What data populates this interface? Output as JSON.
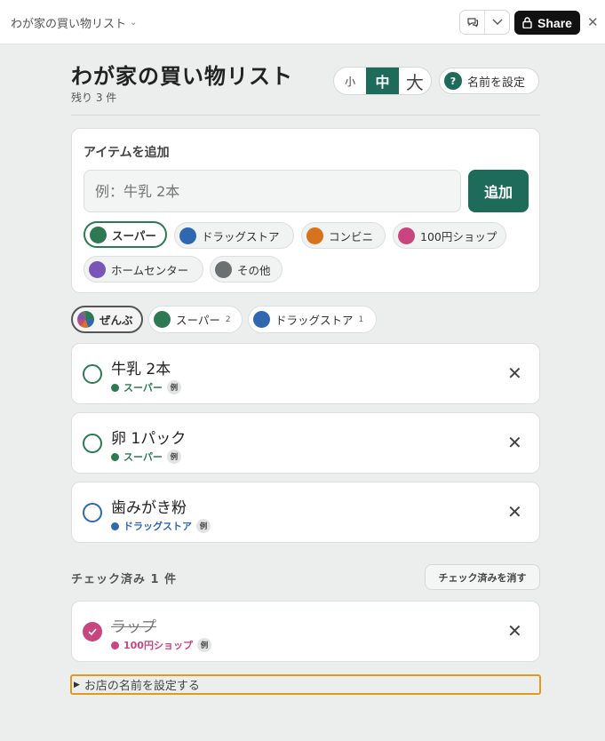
{
  "topbar": {
    "title": "わが家の買い物リスト",
    "share_label": "Share",
    "chat_icon": "chat-icon",
    "dropdown_icon": "chevron-down-icon"
  },
  "header": {
    "title": "わが家の買い物リスト",
    "remaining": "残り 3 件",
    "sizes": [
      "小",
      "中",
      "大"
    ],
    "selected_size": "中",
    "name_button_icon": "?",
    "name_button_label": "名前を設定"
  },
  "add": {
    "heading": "アイテムを追加",
    "placeholder": "例：牛乳 2本",
    "button_label": "追加",
    "stores": [
      {
        "label": "スーパー",
        "color": "#2d7a52",
        "selected": true
      },
      {
        "label": "ドラッグストア",
        "color": "#2f68b0"
      },
      {
        "label": "コンビニ",
        "color": "#d9721c"
      },
      {
        "label": "100円ショップ",
        "color": "#c84580"
      },
      {
        "label": "ホームセンター",
        "color": "#7a55b8"
      },
      {
        "label": "その他",
        "color": "#6d7070"
      }
    ]
  },
  "filters": [
    {
      "label": "ぜんぶ",
      "count": ""
    },
    {
      "label": "スーパー",
      "count": "2"
    },
    {
      "label": "ドラッグストア",
      "count": "1"
    }
  ],
  "items": [
    {
      "name": "牛乳 2本",
      "store": "スーパー",
      "badge": "例",
      "color": "#2d7a52"
    },
    {
      "name": "卵 1パック",
      "store": "スーパー",
      "badge": "例",
      "color": "#2d7a52"
    },
    {
      "name": "歯みがき粉",
      "store": "ドラッグストア",
      "badge": "例",
      "color": "#2f68b0"
    }
  ],
  "done": {
    "heading": "チェック済み 1 件",
    "clear_label": "チェック済みを消す",
    "items": [
      {
        "name": "ラップ",
        "store": "100円ショップ",
        "badge": "例",
        "color": "#c84580"
      }
    ]
  },
  "details_label": "お店の名前を設定する",
  "colors": {
    "accent": "#1f6b5b"
  }
}
